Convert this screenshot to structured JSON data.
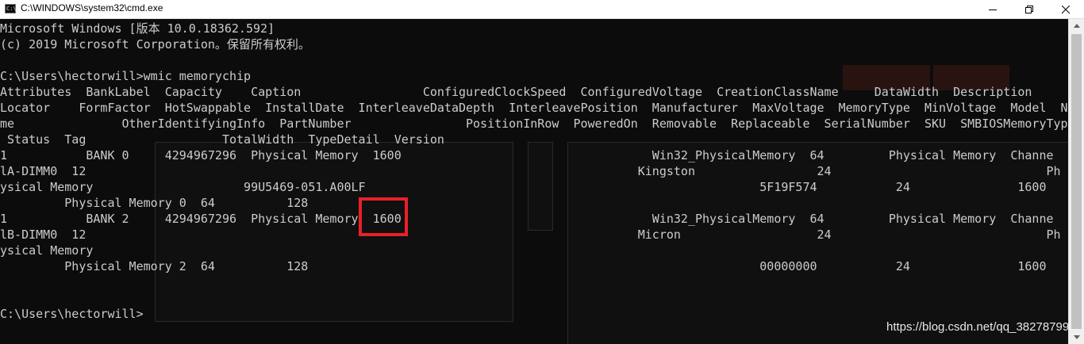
{
  "window": {
    "title": "C:\\WINDOWS\\system32\\cmd.exe",
    "icon": "console-icon"
  },
  "controls": {
    "minimize": "minimize-icon",
    "maximize": "maximize-icon",
    "close": "close-icon"
  },
  "console": {
    "lines": [
      "Microsoft Windows [版本 10.0.18362.592]",
      "(c) 2019 Microsoft Corporation。保留所有权利。",
      "",
      "C:\\Users\\hectorwill>wmic memorychip",
      "Attributes  BankLabel  Capacity    Caption                 ConfiguredClockSpeed  ConfiguredVoltage  CreationClassName     DataWidth  Description      Device",
      "Locator    FormFactor  HotSwappable  InstallDate  InterleaveDataDepth  InterleavePosition  Manufacturer  MaxVoltage  MemoryType  MinVoltage  Model  Na",
      "me               OtherIdentifyingInfo  PartNumber                PositionInRow  PoweredOn  Removable  Replaceable  SerialNumber  SKU  SMBIOSMemoryType  Speed",
      " Status  Tag                   TotalWidth  TypeDetail  Version",
      "1           BANK 0     4294967296  Physical Memory  1600                                   Win32_PhysicalMemory  64         Physical Memory  Channe",
      "lA-DIMM0  12                                                                             Kingston                 24                              Ph",
      "ysical Memory                     99U5469-051.A00LF                                                       5F19F574           24               1600",
      "         Physical Memory 0  64          128",
      "1           BANK 2     4294967296  Physical Memory  1600                                   Win32_PhysicalMemory  64         Physical Memory  Channe",
      "lB-DIMM0  12                                                                             Micron                   24                              Ph",
      "ysical Memory",
      "         Physical Memory 2  64          128                                                               00000000           24               1600",
      "",
      "",
      "C:\\Users\\hectorwill>"
    ]
  },
  "annotation": {
    "highlight_color": "#e8202a"
  },
  "watermark": {
    "text": "https://blog.csdn.net/qq_38278799"
  },
  "scrollbar": {
    "up": "scroll-up-arrow-icon",
    "down": "scroll-down-arrow-icon"
  }
}
